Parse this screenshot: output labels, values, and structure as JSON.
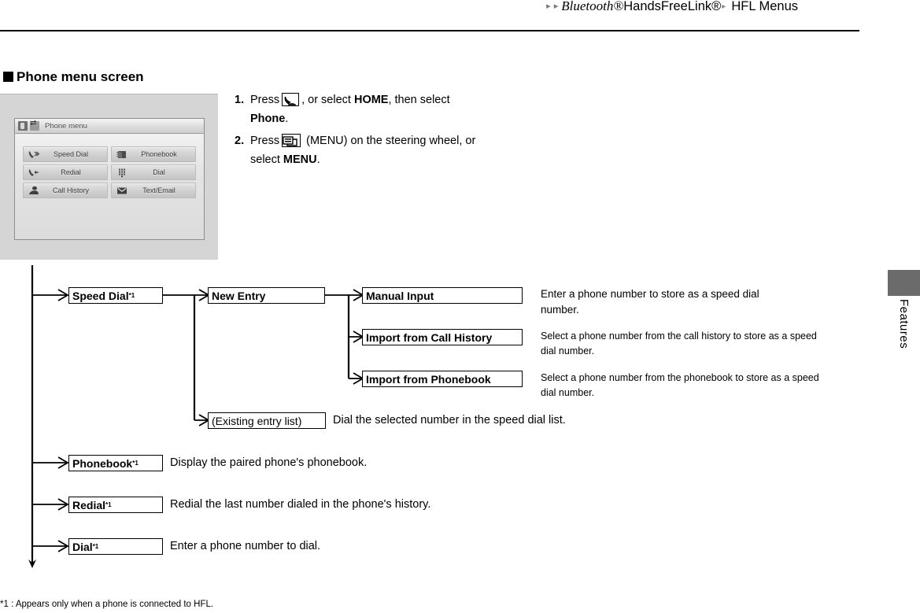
{
  "header": {
    "breadcrumb_arrow": "▸",
    "bluetooth": "Bluetooth®",
    "handsfreelink": "HandsFreeLink®",
    "separator": "▸",
    "page_title": "HFL Menus"
  },
  "section": {
    "heading": "Phone menu screen"
  },
  "nav_screenshot": {
    "title": "Phone menu",
    "titlebar_icons": [
      "phone-signal-icon",
      "bluetooth-transfer-icon"
    ],
    "buttons": [
      {
        "label": "Speed Dial",
        "icon": "speed-dial-icon"
      },
      {
        "label": "Phonebook",
        "icon": "phonebook-icon"
      },
      {
        "label": "Redial",
        "icon": "redial-icon"
      },
      {
        "label": "Dial",
        "icon": "keypad-icon"
      },
      {
        "label": "Call History",
        "icon": "call-history-icon"
      },
      {
        "label": "Text/Email",
        "icon": "envelope-icon"
      }
    ]
  },
  "steps": [
    {
      "num": "1.",
      "pre": "Press",
      "icon": "phone-pickup-icon",
      "mid": ", or select ",
      "bold1": "HOME",
      "post": ", then select",
      "line2_bold": "Phone",
      "line2_post": "."
    },
    {
      "num": "2.",
      "pre": "Press",
      "icon": "menu-button-icon",
      "mid": "(MENU) on the steering wheel, or",
      "line2_pre": "select ",
      "line2_bold": "MENU",
      "line2_post": "."
    }
  ],
  "flow": {
    "level1": [
      {
        "label": "Speed Dial",
        "sup": "*1"
      },
      {
        "label": "Phonebook",
        "sup": "*1",
        "desc": "Display the paired phone's phonebook."
      },
      {
        "label": "Redial",
        "sup": "*1",
        "desc": "Redial the last number dialed in the phone's history."
      },
      {
        "label": "Dial",
        "sup": "*1",
        "desc": "Enter a phone number to dial."
      }
    ],
    "level2": [
      {
        "label": "New Entry"
      },
      {
        "label": "(Existing entry list)",
        "desc": "Dial the selected number in the speed dial list."
      }
    ],
    "level3": [
      {
        "label": "Manual Input",
        "desc": "Enter a phone number to store as a speed dial number."
      },
      {
        "label": "Import from Call History",
        "desc": "Select a phone number from the call history to store as a speed dial number."
      },
      {
        "label": "Import from Phonebook",
        "desc": "Select a phone number from the phonebook to store as a speed dial number."
      }
    ]
  },
  "footnote": "*1 : Appears only when a phone is connected to HFL.",
  "side_tab": {
    "label": "Features",
    "color": "#6b6b6b"
  }
}
